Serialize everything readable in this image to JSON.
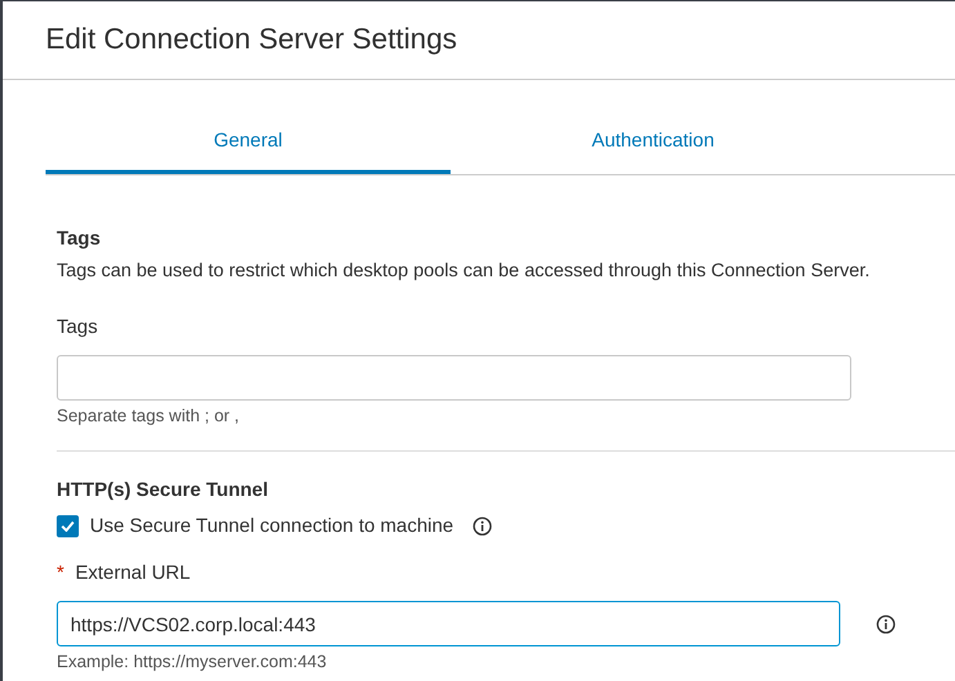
{
  "window": {
    "title": "Edit Connection Server Settings"
  },
  "tabs": [
    {
      "label": "General",
      "selected": true
    },
    {
      "label": "Authentication",
      "selected": false
    }
  ],
  "tags_section": {
    "heading": "Tags",
    "description": "Tags can be used to restrict which desktop pools can be accessed through this Connection Server.",
    "field": {
      "label": "Tags",
      "hint": "Separate tags with ; or ,"
    }
  },
  "tunnel_section": {
    "heading": "HTTP(s) Secure Tunnel",
    "checkbox": {
      "label": "Use Secure Tunnel connection to machine",
      "checked": true
    },
    "field": {
      "required_mark": "*",
      "label": "External URL",
      "value": "https://VCS02.corp.local:443",
      "focused": true,
      "hint": "Example: https://myserver.com:443"
    }
  }
}
